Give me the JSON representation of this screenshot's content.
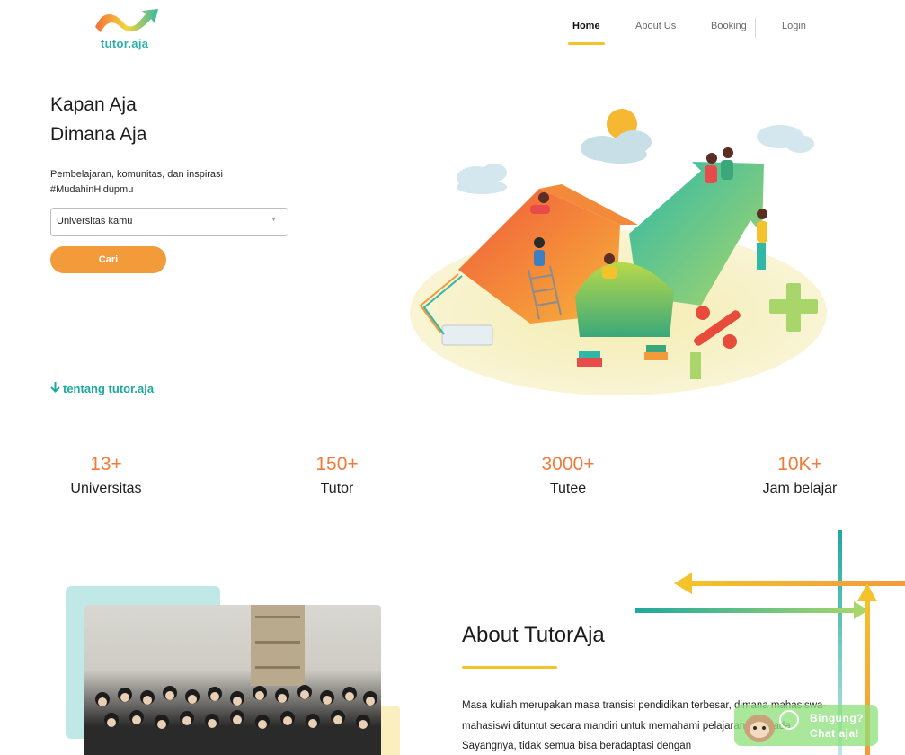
{
  "brand": {
    "name": "tutor.aja"
  },
  "nav": {
    "items": [
      {
        "label": "Home",
        "active": true
      },
      {
        "label": "About Us",
        "active": false
      },
      {
        "label": "Booking",
        "active": false
      },
      {
        "label": "Login",
        "active": false
      }
    ]
  },
  "hero": {
    "title_line1": "Kapan Aja",
    "title_line2": "Dimana Aja",
    "subtitle_line1": "Pembelajaran, komunitas, dan inspirasi",
    "subtitle_line2": "#MudahinHidupmu",
    "select_value": "Universitas kamu",
    "search_button": "Cari",
    "about_link": "tentang tutor.aja"
  },
  "stats": [
    {
      "value": "13+",
      "label": "Universitas"
    },
    {
      "value": "150+",
      "label": "Tutor"
    },
    {
      "value": "3000+",
      "label": "Tutee"
    },
    {
      "value": "10K+",
      "label": "Jam belajar"
    }
  ],
  "about": {
    "title": "About TutorAja",
    "body": "Masa kuliah merupakan masa transisi pendidikan terbesar, dimana mahasiswa-mahasiswi dituntut secara mandiri untuk memahami pelajaran yang ada. Sayangnya, tidak semua bisa beradaptasi dengan"
  },
  "chat": {
    "line1": "Bingung?",
    "line2": "Chat aja!"
  },
  "colors": {
    "accent_orange": "#f39a3b",
    "stat_orange": "#f07b3a",
    "teal": "#1fa99e",
    "yellow": "#f4c22b"
  }
}
